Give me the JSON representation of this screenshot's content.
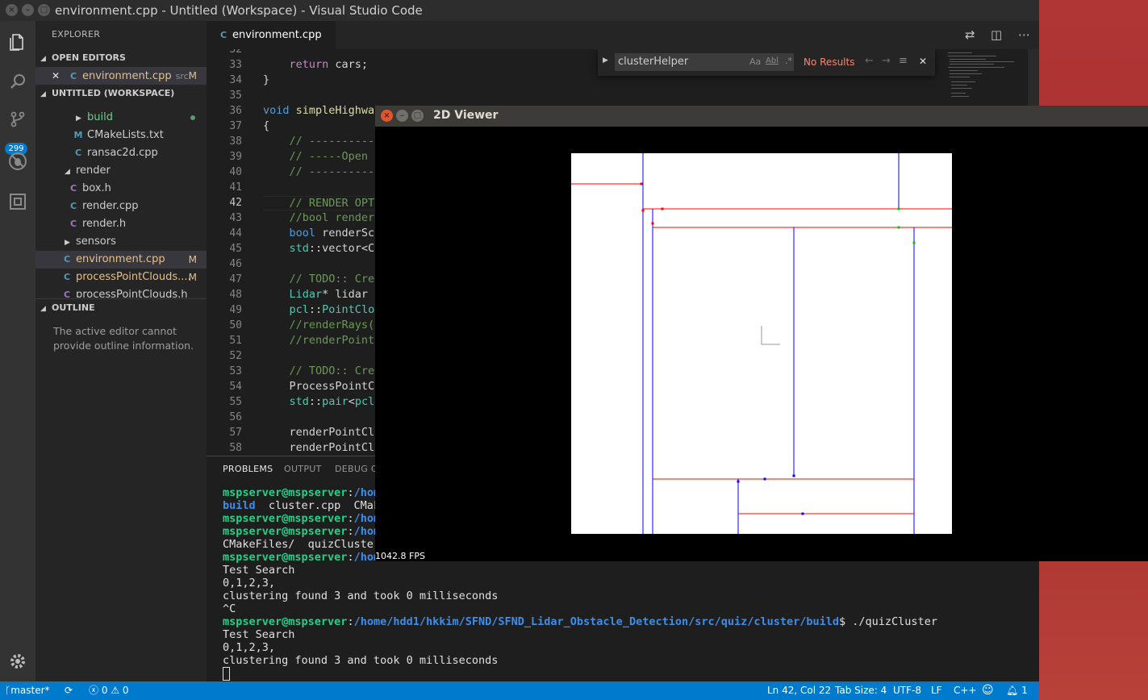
{
  "window": {
    "title": "environment.cpp - Untitled (Workspace) - Visual Studio Code"
  },
  "activity_bar": {
    "scm_badge": "299"
  },
  "sidebar": {
    "title": "EXPLORER",
    "open_editors_header": "OPEN EDITORS",
    "open_editor": {
      "name": "environment.cpp",
      "path": "src",
      "status": "M"
    },
    "workspace_header": "UNTITLED (WORKSPACE)",
    "tree": [
      {
        "label": "build",
        "type": "folder"
      },
      {
        "label": "CMakeLists.txt",
        "type": "cmake"
      },
      {
        "label": "ransac2d.cpp",
        "type": "cpp"
      },
      {
        "label": "render",
        "type": "folder-open"
      },
      {
        "label": "box.h",
        "type": "h"
      },
      {
        "label": "render.cpp",
        "type": "cpp"
      },
      {
        "label": "render.h",
        "type": "h"
      },
      {
        "label": "sensors",
        "type": "folder"
      },
      {
        "label": "environment.cpp",
        "type": "cpp",
        "status": "M"
      },
      {
        "label": "processPointClouds....",
        "type": "cpp",
        "status": "M"
      },
      {
        "label": "processPointClouds.h",
        "type": "h"
      }
    ],
    "outline_header": "OUTLINE",
    "outline_message": "The active editor cannot provide outline information."
  },
  "tab": {
    "label": "environment.cpp",
    "close": "✕"
  },
  "find": {
    "query": "clusterHelper",
    "opt_case": "Aa",
    "opt_word": "Abl",
    "opt_regex": ".*",
    "result": "No Results",
    "close": "✕"
  },
  "editor": {
    "current_line": "42",
    "lines": [
      {
        "n": "32",
        "t": ""
      },
      {
        "n": "33",
        "t": "    return cars;"
      },
      {
        "n": "34",
        "t": "}"
      },
      {
        "n": "35",
        "t": ""
      },
      {
        "n": "36",
        "t": "void simpleHighwa"
      },
      {
        "n": "37",
        "t": "{"
      },
      {
        "n": "38",
        "t": "    // ----------"
      },
      {
        "n": "39",
        "t": "    // -----Open"
      },
      {
        "n": "40",
        "t": "    // ----------"
      },
      {
        "n": "41",
        "t": ""
      },
      {
        "n": "42",
        "t": "    // RENDER OPT"
      },
      {
        "n": "43",
        "t": "    //bool render"
      },
      {
        "n": "44",
        "t": "    bool renderSc"
      },
      {
        "n": "45",
        "t": "    std::vector<C"
      },
      {
        "n": "46",
        "t": ""
      },
      {
        "n": "47",
        "t": "    // TODO:: Cre"
      },
      {
        "n": "48",
        "t": "    Lidar* lidar"
      },
      {
        "n": "49",
        "t": "    pcl::PointClo"
      },
      {
        "n": "50",
        "t": "    //renderRays("
      },
      {
        "n": "51",
        "t": "    //renderPoint"
      },
      {
        "n": "52",
        "t": ""
      },
      {
        "n": "53",
        "t": "    // TODO:: Cre"
      },
      {
        "n": "54",
        "t": "    ProcessPointC"
      },
      {
        "n": "55",
        "t": "    std::pair<pcl"
      },
      {
        "n": "56",
        "t": ""
      },
      {
        "n": "57",
        "t": "    renderPointCl"
      },
      {
        "n": "58",
        "t": "    renderPointCl"
      }
    ]
  },
  "panel": {
    "tabs": [
      "PROBLEMS",
      "OUTPUT",
      "DEBUG CO"
    ],
    "terminal": [
      {
        "prompt": "mspserver@mspserver",
        "sep": ":",
        "path": "/hom",
        "rest": ""
      },
      {
        "prompt": "",
        "sep": "",
        "path": "",
        "rest": "",
        "build": "build",
        "after": "  cluster.cpp  CMak"
      },
      {
        "prompt": "mspserver@mspserver",
        "sep": ":",
        "path": "/hom",
        "rest": ""
      },
      {
        "prompt": "mspserver@mspserver",
        "sep": ":",
        "path": "/hom",
        "rest": ""
      },
      {
        "prompt": "",
        "sep": "",
        "path": "",
        "rest": "CMakeFiles/  quizCluster"
      },
      {
        "prompt": "mspserver@mspserver",
        "sep": ":",
        "path": "/hom",
        "rest": ""
      },
      {
        "prompt": "",
        "sep": "",
        "path": "",
        "rest": "Test Search"
      },
      {
        "prompt": "",
        "sep": "",
        "path": "",
        "rest": "0,1,2,3,"
      },
      {
        "prompt": "",
        "sep": "",
        "path": "",
        "rest": "clustering found 3 and took 0 milliseconds"
      },
      {
        "prompt": "",
        "sep": "",
        "path": "",
        "rest": "^C"
      },
      {
        "prompt": "mspserver@mspserver",
        "sep": ":",
        "path": "/home/hdd1/hkkim/SFND/SFND_Lidar_Obstacle_Detection/src/quiz/cluster/build",
        "rest": "$ ./quizCluster"
      },
      {
        "prompt": "",
        "sep": "",
        "path": "",
        "rest": "Test Search"
      },
      {
        "prompt": "",
        "sep": "",
        "path": "",
        "rest": "0,1,2,3,"
      },
      {
        "prompt": "",
        "sep": "",
        "path": "",
        "rest": "clustering found 3 and took 0 milliseconds"
      }
    ]
  },
  "status_bar": {
    "branch": "master*",
    "errors": "0",
    "warnings": "0",
    "position": "Ln 42, Col 22",
    "tab_size": "Tab Size: 4",
    "encoding": "UTF-8",
    "eol": "LF",
    "language": "C++",
    "notifications": "1"
  },
  "viewer": {
    "title": "2D Viewer",
    "fps": "1042.8 FPS",
    "colors": {
      "background": "#000000",
      "plot": "#ffffff",
      "split_x": "#ff0000",
      "split_y": "#0000ff",
      "point_a": "#ff0000",
      "point_b": "#00cc00",
      "point_c": "#0000ff"
    }
  }
}
